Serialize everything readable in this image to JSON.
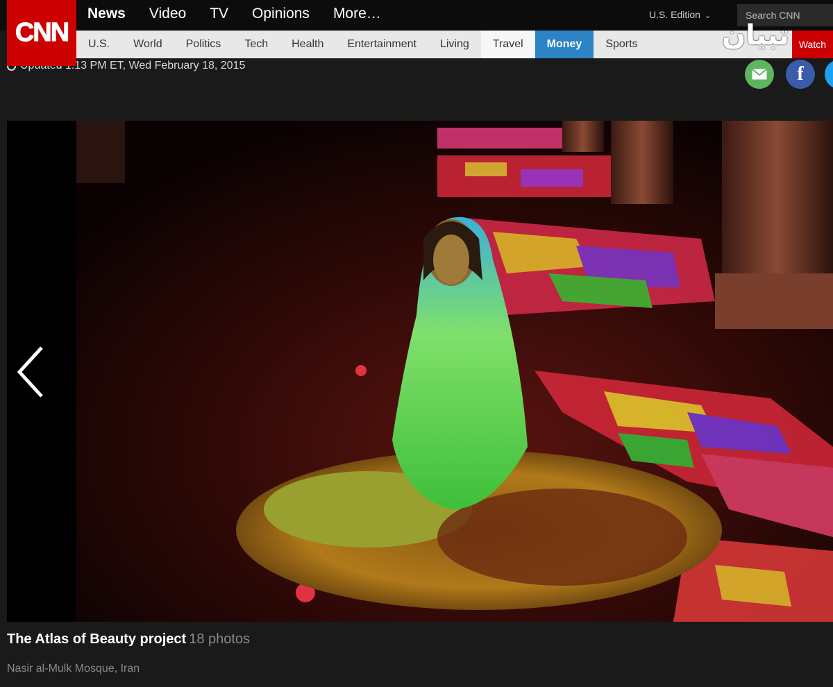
{
  "brand": {
    "logo_text": "CNN"
  },
  "primary_nav": [
    "News",
    "Video",
    "TV",
    "Opinions",
    "More…"
  ],
  "edition": "U.S. Edition",
  "search": {
    "placeholder": "Search CNN"
  },
  "sub_nav": [
    "U.S.",
    "World",
    "Politics",
    "Tech",
    "Health",
    "Entertainment",
    "Living",
    "Travel",
    "Money",
    "Sports"
  ],
  "sub_nav_partial": "Watch",
  "updated": "Updated 1:13 PM ET, Wed February 18, 2015",
  "watermark": "ﺗﺒﯿﺎﻥ",
  "share": {
    "facebook_glyph": "f"
  },
  "gallery": {
    "title": "The Atlas of Beauty project",
    "count": "18 photos",
    "caption": "Nasir al-Mulk Mosque, Iran"
  },
  "colors": {
    "cnn_red": "#cc0000",
    "money_blue": "#2c84c6",
    "email_green": "#5fb55f",
    "facebook_blue": "#3b5bab"
  }
}
